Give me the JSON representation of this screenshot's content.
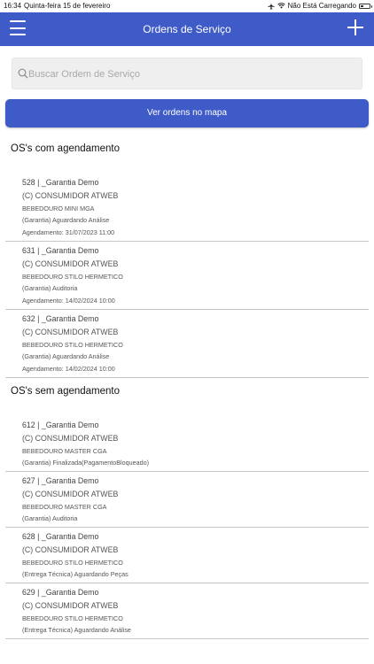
{
  "status_bar": {
    "time": "16:34",
    "date": "Quinta-feira 15 de fevereiro",
    "charging": "Não Está Carregando"
  },
  "header": {
    "title": "Ordens de Serviço"
  },
  "search": {
    "placeholder": "Buscar Ordem de Serviço"
  },
  "map_button": {
    "label": "Ver ordens no mapa"
  },
  "section_with_schedule": {
    "title": "OS's com agendamento",
    "items": [
      {
        "title": "528 | _Garantia Demo",
        "client": "(C) CONSUMIDOR ATWEB",
        "product": "BEBEDOURO MINI MGA",
        "status": "(Garantia) Aguardando Análise",
        "schedule": "Agendamento: 31/07/2023 11:00"
      },
      {
        "title": "631 | _Garantia Demo",
        "client": "(C) CONSUMIDOR ATWEB",
        "product": "BEBEDOURO STILO HERMETICO",
        "status": "(Garantia) Auditoria",
        "schedule": "Agendamento: 14/02/2024 10:00"
      },
      {
        "title": "632 | _Garantia Demo",
        "client": "(C) CONSUMIDOR ATWEB",
        "product": "BEBEDOURO STILO HERMETICO",
        "status": "(Garantia) Aguardando Análise",
        "schedule": "Agendamento: 14/02/2024 10:00"
      }
    ]
  },
  "section_without_schedule": {
    "title": "OS's sem agendamento",
    "items": [
      {
        "title": "612 | _Garantia Demo",
        "client": "(C) CONSUMIDOR ATWEB",
        "product": "BEBEDOURO MASTER CGA",
        "status": "(Garantia) Finalizada(PagamentoBloqueado)"
      },
      {
        "title": "627 | _Garantia Demo",
        "client": "(C) CONSUMIDOR ATWEB",
        "product": "BEBEDOURO MASTER CGA",
        "status": "(Garantia) Auditoria"
      },
      {
        "title": "628 | _Garantia Demo",
        "client": "(C) CONSUMIDOR ATWEB",
        "product": "BEBEDOURO STILO HERMETICO",
        "status": "(Entrega Técnica) Aguardando Peças"
      },
      {
        "title": "629 | _Garantia Demo",
        "client": "(C) CONSUMIDOR ATWEB",
        "product": "BEBEDOURO STILO HERMETICO",
        "status": "(Entrega Técnica) Aguardando Análise"
      }
    ]
  },
  "colors": {
    "primary": "#3f5bc8"
  }
}
